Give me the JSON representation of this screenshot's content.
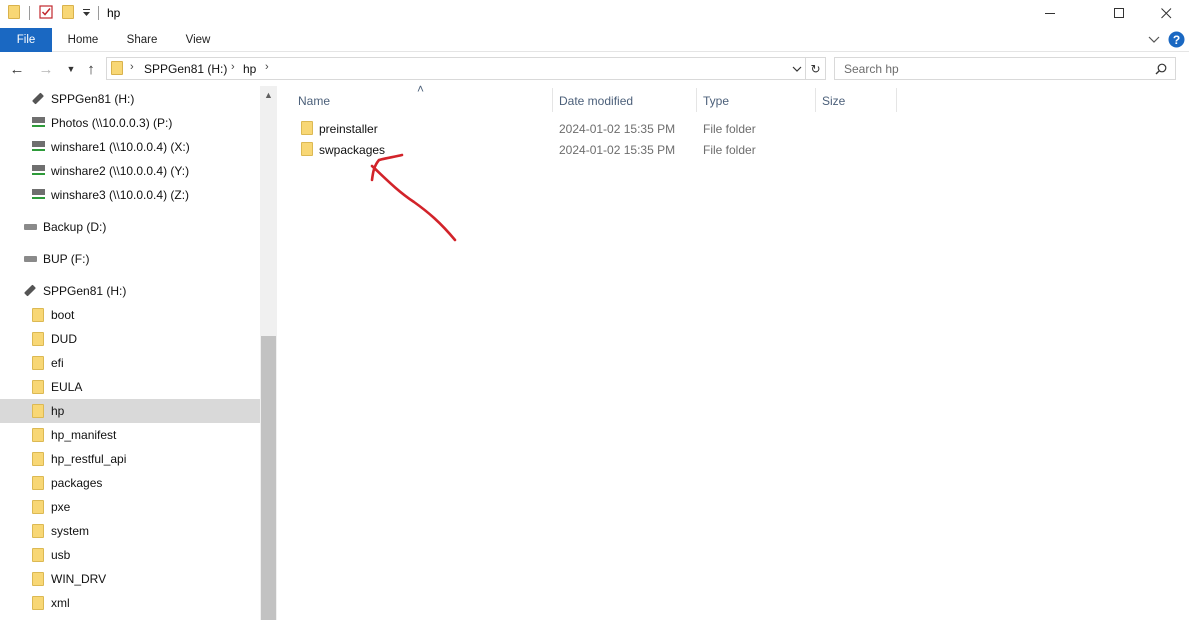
{
  "window": {
    "title": "hp",
    "minimize_icon": "minimize-icon",
    "maximize_icon": "maximize-icon",
    "close_icon": "close-icon"
  },
  "ribbon": {
    "tabs": [
      "File",
      "Home",
      "Share",
      "View"
    ]
  },
  "address": {
    "crumbs": [
      "SPPGen81 (H:)",
      "hp"
    ],
    "search_placeholder": "Search hp"
  },
  "navpane": {
    "items": [
      {
        "label": "SPPGen81 (H:)",
        "icon": "usb-drive-icon"
      },
      {
        "label": "Photos (\\\\10.0.0.3) (P:)",
        "icon": "network-drive-icon"
      },
      {
        "label": "winshare1 (\\\\10.0.0.4) (X:)",
        "icon": "network-drive-icon"
      },
      {
        "label": "winshare2 (\\\\10.0.0.4) (Y:)",
        "icon": "network-drive-icon"
      },
      {
        "label": "winshare3 (\\\\10.0.0.4) (Z:)",
        "icon": "network-drive-icon"
      },
      {
        "label": "Backup (D:)",
        "icon": "drive-icon"
      },
      {
        "label": "BUP (F:)",
        "icon": "drive-icon"
      },
      {
        "label": "SPPGen81 (H:)",
        "icon": "usb-drive-icon"
      },
      {
        "label": "boot",
        "icon": "folder-icon"
      },
      {
        "label": "DUD",
        "icon": "folder-icon"
      },
      {
        "label": "efi",
        "icon": "folder-icon"
      },
      {
        "label": "EULA",
        "icon": "folder-icon"
      },
      {
        "label": "hp",
        "icon": "folder-icon",
        "selected": true
      },
      {
        "label": "hp_manifest",
        "icon": "folder-icon"
      },
      {
        "label": "hp_restful_api",
        "icon": "folder-icon"
      },
      {
        "label": "packages",
        "icon": "folder-icon"
      },
      {
        "label": "pxe",
        "icon": "folder-icon"
      },
      {
        "label": "system",
        "icon": "folder-icon"
      },
      {
        "label": "usb",
        "icon": "folder-icon"
      },
      {
        "label": "WIN_DRV",
        "icon": "folder-icon"
      },
      {
        "label": "xml",
        "icon": "folder-icon"
      }
    ]
  },
  "files": {
    "columns": [
      "Name",
      "Date modified",
      "Type",
      "Size"
    ],
    "rows": [
      {
        "name": "preinstaller",
        "date": "2024-01-02 15:35 PM",
        "type": "File folder"
      },
      {
        "name": "swpackages",
        "date": "2024-01-02 15:35 PM",
        "type": "File folder"
      }
    ]
  },
  "colors": {
    "file_tab": "#1a68c2",
    "selection": "#d9d9d9",
    "annotation": "#d2232a"
  }
}
